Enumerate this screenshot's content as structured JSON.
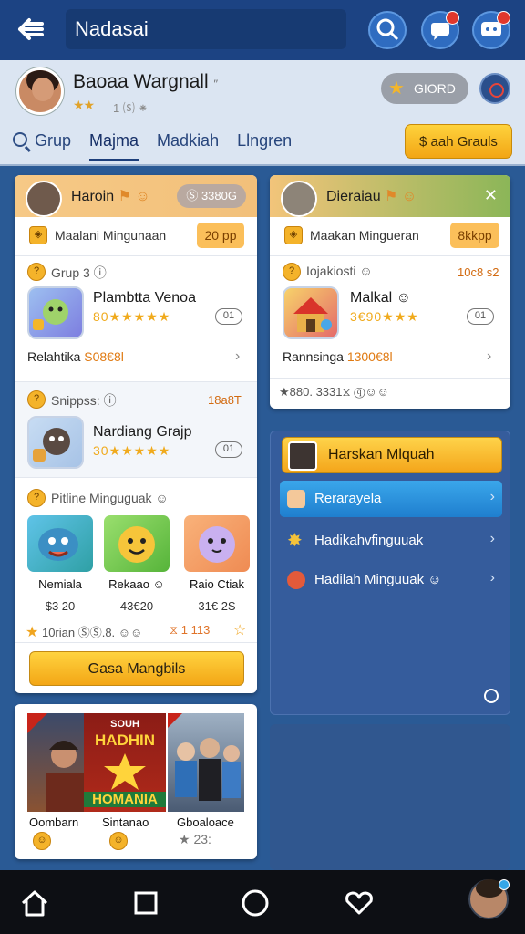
{
  "header": {
    "title": "Nadasai",
    "back_icon": "back-arrow-icon"
  },
  "profile": {
    "name": "Baoaa Wargnall",
    "name_extra": "′′",
    "stars": "★★",
    "stars_tail": "1 ⒮ ⁕",
    "badge_label": "GIORD",
    "tabs": [
      "Grup",
      "Majma",
      "Madkiah",
      "Llngren"
    ],
    "action_button": "$ aah Grauls"
  },
  "card1": {
    "user_name": "Haroin",
    "user_pill": "Ⓢ 3380G",
    "offer_label": "Maalani Mingunaan",
    "offer_button": "20 pp",
    "section1_label": "Grup 3 ⓘ",
    "app1": {
      "name": "Plambtta Venoa",
      "stars": "★",
      "rating_text": "80★★★★★",
      "pill": "01",
      "line_label": "Relahtika",
      "line_value": "S08€8l"
    },
    "section2_label": "Snippss: ⓘ",
    "section2_value": "18a8T",
    "app2": {
      "name": "Nardiang Grajp",
      "stars": "★",
      "rating_text": "30★★★★★",
      "pill": "01"
    },
    "section3_label": "Pitline Minguguak ☺",
    "tiles": [
      {
        "name": "Nemiala",
        "price": "$3 20"
      },
      {
        "name": "Rekaao ☺",
        "price": "43€20"
      },
      {
        "name": "Raio Ctiak",
        "price": "31€ 2S"
      }
    ],
    "stats_left": "10rian ⓈⓈ.8. ☺☺",
    "stats_right": "⧖ 1 113",
    "main_button": "Gasa Mangbils"
  },
  "card2": {
    "user_name": "Dieraiau",
    "offer_label": "Maakan Mingueran",
    "offer_button": "8kkpp",
    "section1_label": "Iojakiosti ☺",
    "section1_value": "10c8 s2",
    "app1": {
      "name": "Malkal ☺",
      "rating_text": "3€90★★★",
      "pill": "01",
      "line_label": "Rannsinga",
      "line_value": "1300€8l"
    },
    "bottom_stats": "★880. 3331⧖ ⓠ☺☺"
  },
  "panel": {
    "header_name": "Harskan Mlquah",
    "items": [
      {
        "label": "Rerarayela",
        "selected": true
      },
      {
        "label": "Hadikahvfinguuak",
        "selected": false
      },
      {
        "label": "Hadilah Minguuak ☺",
        "selected": false
      }
    ]
  },
  "media": {
    "banner_line1": "SOUH",
    "banner_line2": "HADHIN",
    "banner_line3": "HOMANIA",
    "captions": [
      "Oombarn",
      "Sintanao",
      "Gboaloace"
    ],
    "cap_value": "★ 23:"
  },
  "colors": {
    "topbar": "#1c4383",
    "accent_gold": "#f4b62a",
    "accent_blue": "#2f6cc0",
    "background": "#2a5a95"
  }
}
